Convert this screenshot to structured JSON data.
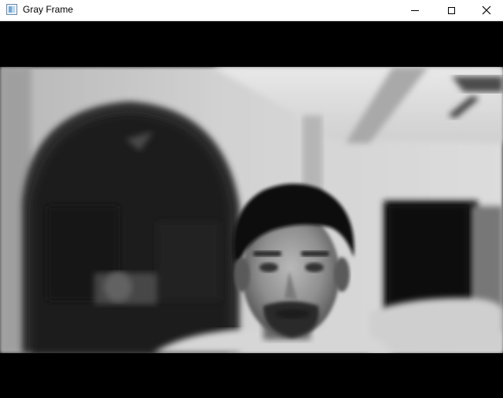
{
  "window": {
    "title": "Gray Frame",
    "icons": {
      "app": "opencv-window-icon",
      "minimize": "minimize-icon",
      "maximize": "maximize-icon",
      "close": "close-icon"
    }
  },
  "video": {
    "mode": "grayscale",
    "content": "webcam-frame"
  }
}
